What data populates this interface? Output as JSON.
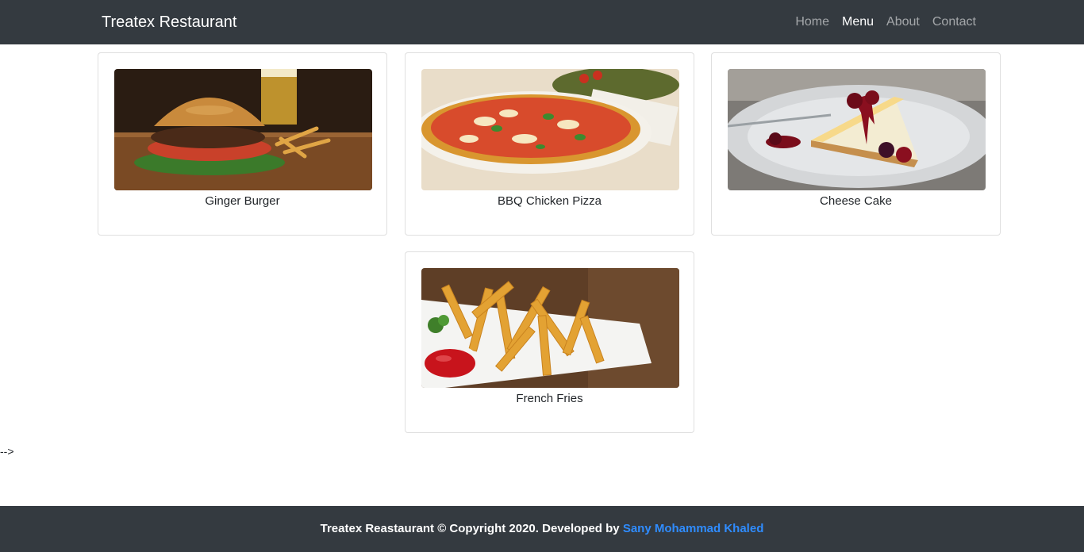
{
  "navbar": {
    "brand": "Treatex Restaurant",
    "links": [
      {
        "label": "Home",
        "active": false
      },
      {
        "label": "Menu",
        "active": true
      },
      {
        "label": "About",
        "active": false
      },
      {
        "label": "Contact",
        "active": false
      }
    ]
  },
  "menu_items": [
    {
      "name": "Ginger Burger",
      "image": "burger-photo"
    },
    {
      "name": "BBQ Chicken Pizza",
      "image": "pizza-photo"
    },
    {
      "name": "Cheese Cake",
      "image": "cheesecake-photo"
    },
    {
      "name": "French Fries",
      "image": "fries-photo"
    }
  ],
  "stray_text": "-->",
  "footer": {
    "text": "Treatex Reastaurant © Copyright 2020. Developed by ",
    "author": "Sany Mohammad Khaled",
    "link_color": "#2f8cff"
  },
  "colors": {
    "navbar_bg": "#343a40",
    "footer_bg": "#343a40",
    "page_bg": "#ffffff"
  }
}
